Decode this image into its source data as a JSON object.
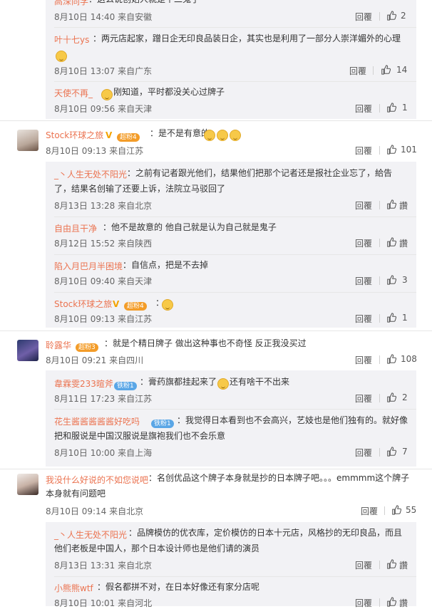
{
  "comments": [
    {
      "replies_before": [
        {
          "name": "高深同学",
          "text": "：这么说创始人就是个二鬼子",
          "meta": "8月10日 14:40 来自安徽",
          "reply": "回覆",
          "likes": "2"
        },
        {
          "name": "叶十七ys",
          "text": "：两元店起家，蹭日企无印良品装日企，其实也是利用了一部分人崇洋媚外的心理",
          "meta": "8月10日 13:07 来自广东",
          "reply": "回覆",
          "likes": "14"
        },
        {
          "name": "天使不再_",
          "text": "刚知道，平时都没关心过牌子",
          "meta": "8月10日 09:56 来自天津",
          "reply": "回覆",
          "likes": "1"
        }
      ]
    },
    {
      "name": "Stock环球之旅",
      "badge": "超粉4",
      "text": "：是不是有意的",
      "meta": "8月10日 09:13 来自江苏",
      "reply": "回覆",
      "likes": "101",
      "replies": [
        {
          "name": "_丶人生无处不阳光",
          "text": "：之前有记者跟光他们，结果他们把那个记者还是报社企业忘了，給告了，结果名创输了还要上诉，法院立马驳回了",
          "meta": "8月13日 13:28 来自北京",
          "reply": "回覆",
          "likes": "讚"
        },
        {
          "name": "自由且干净",
          "text": "：他不是故意的 他自己就是认为自己就是鬼子",
          "meta": "8月12日 15:52 来自陕西",
          "reply": "回覆",
          "likes": "讚"
        },
        {
          "name": "陷入月巴月半困境",
          "text": "：自信点，把是不去掉",
          "meta": "8月10日 09:40 来自天津",
          "reply": "回覆",
          "likes": "3"
        },
        {
          "name": "Stock环球之旅",
          "badge": "超粉4",
          "text": "：",
          "meta": "8月10日 09:13 来自江苏",
          "reply": "回覆",
          "likes": "1"
        }
      ]
    },
    {
      "name": "聆露华",
      "badge": "超粉3",
      "text": "：就是个精日牌子 做出这种事也不奇怪 反正我没买过",
      "meta": "8月10日 09:21 来自四川",
      "reply": "回覆",
      "likes": "108",
      "replies": [
        {
          "name": "韋霖雯233暄斧",
          "badge": "铁粉1",
          "text": "：膏药旗都挂起来了",
          "text2": "还有啥干不出来",
          "meta": "8月11日 17:23 来自江苏",
          "reply": "回覆",
          "likes": "2"
        },
        {
          "name": "花生酱酱酱酱酱好吃吗",
          "badge": "铁粉1",
          "text": "：我觉得日本看到也不会高兴，艺妓也是他们独有的。就好像把和服说是中国汉服说是旗袍我们也不会乐意",
          "meta": "8月10日 10:00 来自上海",
          "reply": "回覆",
          "likes": "7"
        }
      ]
    },
    {
      "name": "我没什么好说的不如您说吧",
      "text": "：名创优品这个牌子本身就是抄的日本牌子吧。。。emmmm这个牌子本身就有问题吧",
      "meta": "8月10日 09:14 来自北京",
      "reply": "回覆",
      "likes": "55",
      "replies": [
        {
          "name": "_丶人生无处不阳光",
          "text": "：品牌模仿的优衣库，定价模仿的日本十元店，风格抄的无印良品，而且他们老板是中国人，那个日本设计师也是他们请的演员",
          "meta": "8月13日 13:31 来自北京",
          "reply": "回覆",
          "likes": "讚"
        },
        {
          "name": "小熊熊wtf",
          "text": "：假名都拼不对，在日本好像还有家分店呢",
          "meta": "8月10日 10:01 来自河北",
          "reply": "回覆",
          "likes": "讚"
        }
      ]
    }
  ],
  "colors": {
    "name": "#eb7350",
    "reply_bg": "#f2f2f5"
  }
}
